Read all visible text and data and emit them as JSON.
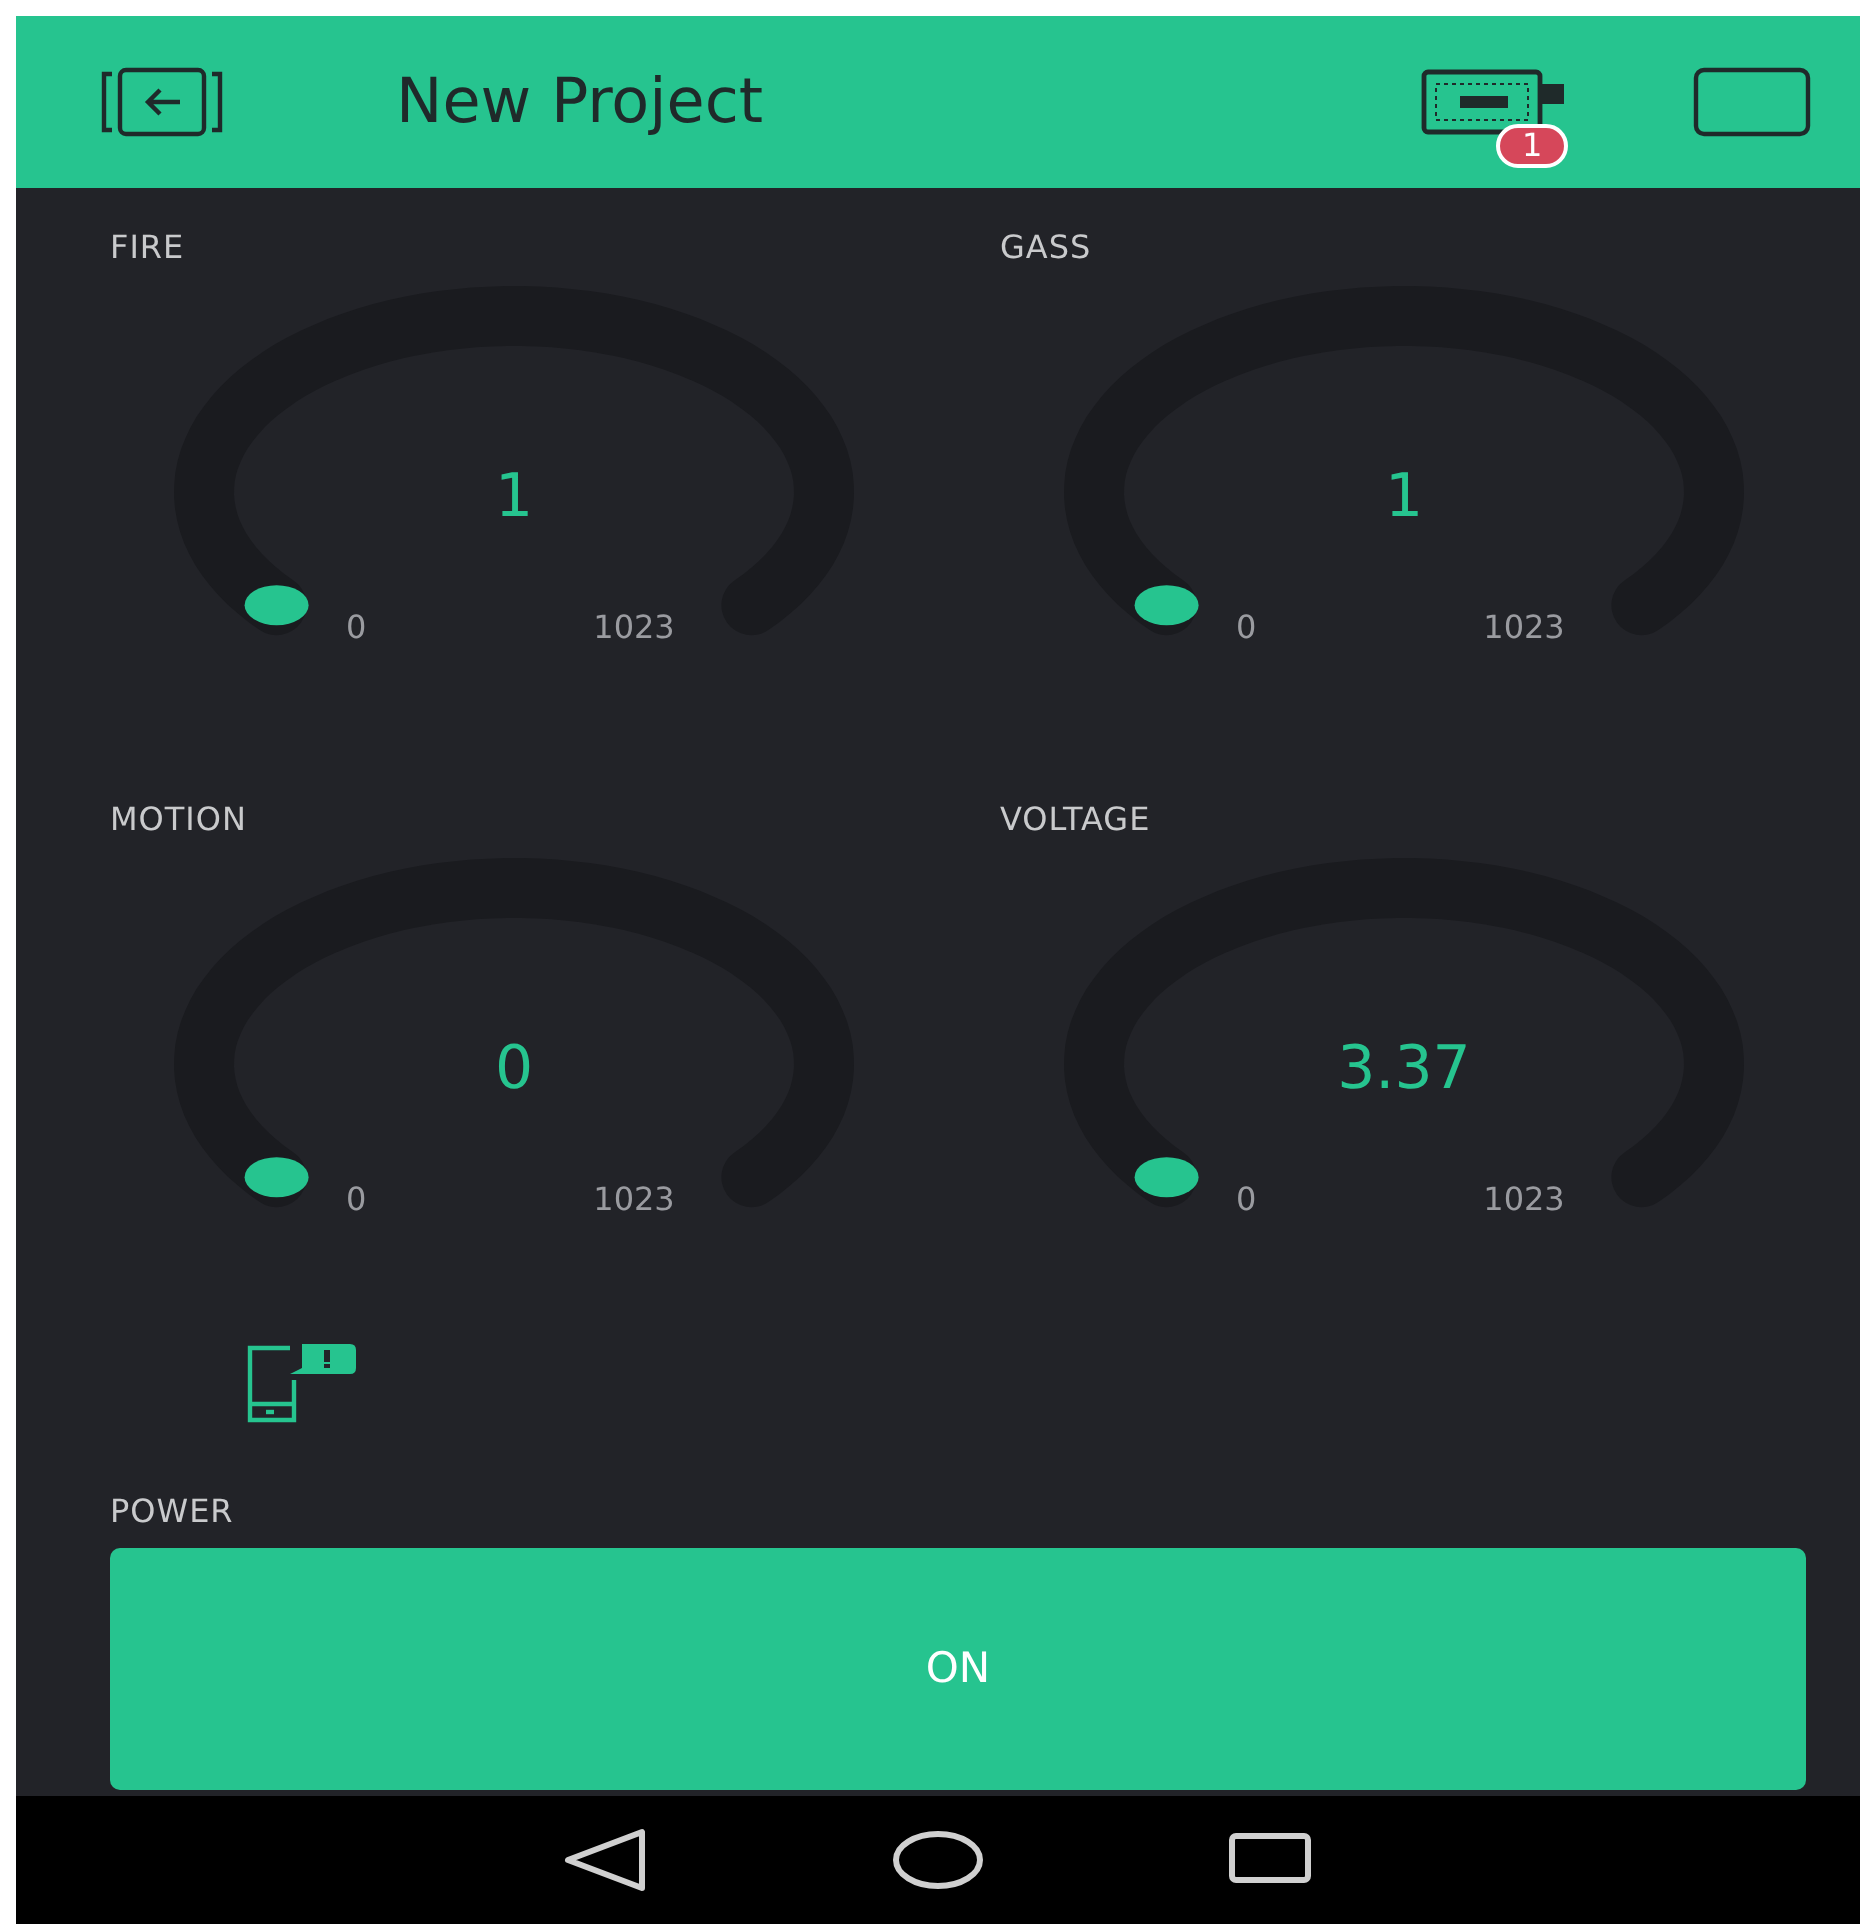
{
  "header": {
    "title": "New Project",
    "badge": "1"
  },
  "gauges": [
    {
      "label": "FIRE",
      "value": "1",
      "min": "0",
      "max": "1023"
    },
    {
      "label": "GASS",
      "value": "1",
      "min": "0",
      "max": "1023"
    },
    {
      "label": "MOTION",
      "value": "0",
      "min": "0",
      "max": "1023"
    },
    {
      "label": "VOLTAGE",
      "value": "3.37",
      "min": "0",
      "max": "1023"
    }
  ],
  "power": {
    "label": "POWER",
    "button": "ON"
  }
}
